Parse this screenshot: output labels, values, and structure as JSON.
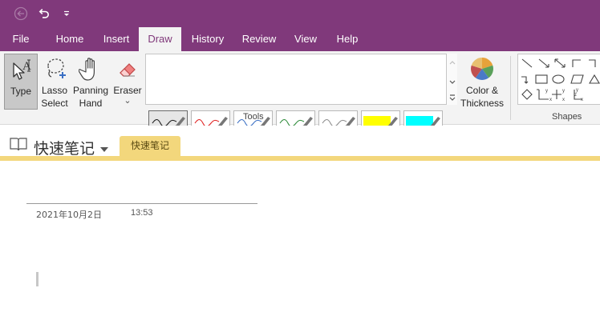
{
  "titlebar": {
    "back_icon": "back-icon",
    "undo_icon": "undo-icon",
    "qat_icon": "customize-quick-access-icon",
    "color": "#80397b"
  },
  "tabs": [
    {
      "label": "File",
      "active": false
    },
    {
      "label": "Home",
      "active": false
    },
    {
      "label": "Insert",
      "active": false
    },
    {
      "label": "Draw",
      "active": true
    },
    {
      "label": "History",
      "active": false
    },
    {
      "label": "Review",
      "active": false
    },
    {
      "label": "View",
      "active": false
    },
    {
      "label": "Help",
      "active": false
    }
  ],
  "ribbon": {
    "type": {
      "label": "Type",
      "selected": true
    },
    "lasso": {
      "line1": "Lasso",
      "line2": "Select"
    },
    "panning": {
      "line1": "Panning",
      "line2": "Hand"
    },
    "eraser": {
      "label": "Eraser",
      "dropdown": "⌄"
    },
    "pens": [
      {
        "color": "#1a1a1a",
        "kind": "pen",
        "selected": true
      },
      {
        "color": "#e02020",
        "kind": "pen"
      },
      {
        "color": "#3a6fc4",
        "kind": "pen"
      },
      {
        "color": "#2e8b3a",
        "kind": "pen"
      },
      {
        "color": "#8c8c8c",
        "kind": "pen"
      },
      {
        "color": "#ffff00",
        "kind": "highlighter"
      },
      {
        "color": "#00ffff",
        "kind": "highlighter"
      },
      {
        "color": "#1a1a1a",
        "kind": "pen-thick"
      },
      {
        "color": "#e02020",
        "kind": "pen-thick"
      },
      {
        "color": "#3a6fc4",
        "kind": "pen-thick"
      },
      {
        "color": "#2e8b3a",
        "kind": "pen-thick"
      },
      {
        "color": "#8c8c8c",
        "kind": "pen-thick"
      },
      {
        "color": "#00ff00",
        "kind": "highlighter"
      },
      {
        "color": "#ff00ff",
        "kind": "highlighter"
      }
    ],
    "color_thickness": {
      "line1": "Color &",
      "line2": "Thickness"
    },
    "tools_label": "Tools",
    "shapes_label": "Shapes"
  },
  "notebook": {
    "title": "快速笔记",
    "section": "快速笔记",
    "section_color": "#f3d77c"
  },
  "page": {
    "date": "2021年10月2日",
    "time": "13:53"
  }
}
